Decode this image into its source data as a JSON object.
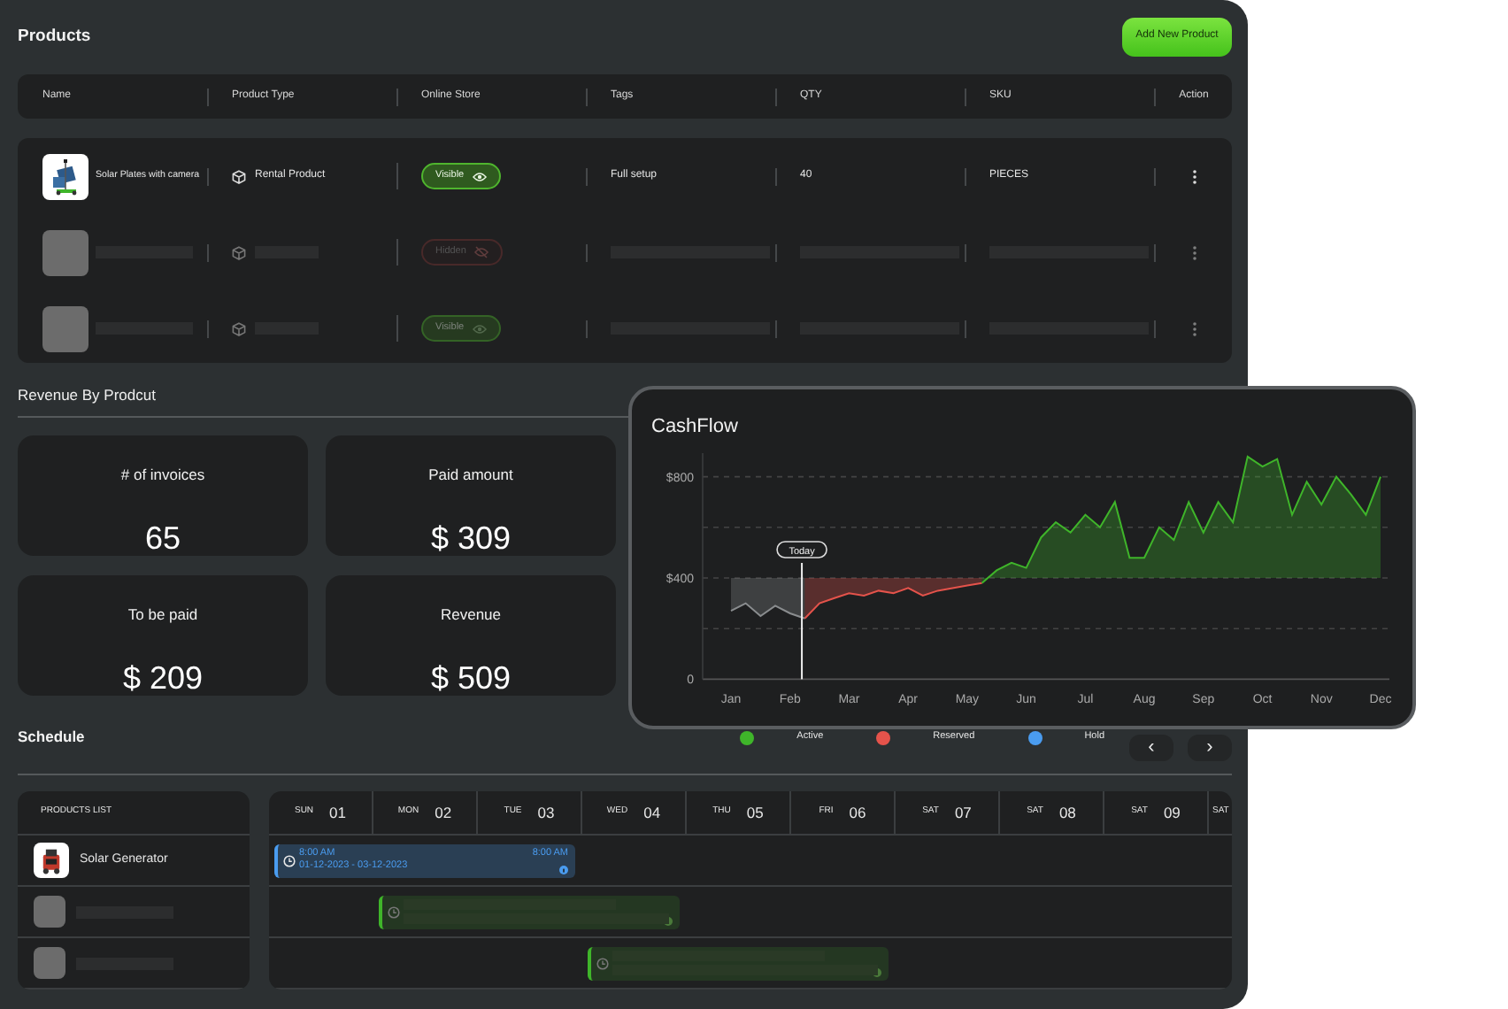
{
  "products": {
    "title": "Products",
    "add_button": "Add New Product",
    "columns": [
      "Name",
      "Product Type",
      "Online Store",
      "Tags",
      "QTY",
      "SKU",
      "Action"
    ],
    "rows": [
      {
        "kind": "item",
        "name": "Solar Plates with camera",
        "type": "Rental Product",
        "store": {
          "label": "Visible",
          "visible": true
        },
        "tags": "Full setup",
        "qty": "40",
        "sku": "PIECES"
      },
      {
        "kind": "placeholder",
        "store": {
          "label": "Hidden",
          "visible": false
        }
      },
      {
        "kind": "placeholder",
        "store": {
          "label": "Visible",
          "visible": true
        }
      }
    ]
  },
  "revenue": {
    "title": "Revenue By Prodcut",
    "cards": [
      {
        "label": "# of invoices",
        "value": "65"
      },
      {
        "label": "Paid amount",
        "value": "$ 309"
      },
      {
        "label": "To be paid",
        "value": "$ 209"
      },
      {
        "label": "Revenue",
        "value": "$ 509"
      }
    ]
  },
  "cashflow": {
    "title": "CashFlow",
    "chart_data": {
      "type": "line",
      "categories": [
        "Jan",
        null,
        null,
        null,
        "Feb",
        null,
        null,
        null,
        "Mar",
        null,
        null,
        null,
        "Apr",
        null,
        null,
        null,
        "May",
        null,
        null,
        null,
        "Jun",
        null,
        null,
        null,
        "Jul",
        null,
        null,
        null,
        "Aug",
        null,
        null,
        null,
        "Sep",
        null,
        null,
        null,
        "Oct",
        null,
        null,
        null,
        "Nov",
        null,
        null,
        null,
        "Dec"
      ],
      "series": [
        {
          "color": "#8a8d8f",
          "values": [
            270,
            300,
            250,
            290,
            260,
            240,
            null,
            null,
            null,
            null,
            null,
            null,
            null,
            null,
            null,
            null,
            null,
            null,
            null,
            null,
            null,
            null,
            null,
            null,
            null,
            null,
            null,
            null,
            null,
            null,
            null,
            null,
            null,
            null,
            null,
            null,
            null,
            null,
            null,
            null,
            null,
            null,
            null,
            null,
            null
          ]
        },
        {
          "color": "#e5534b",
          "values": [
            null,
            null,
            null,
            null,
            null,
            240,
            300,
            320,
            340,
            330,
            350,
            340,
            360,
            330,
            350,
            360,
            370,
            380,
            null,
            null,
            null,
            null,
            null,
            null,
            null,
            null,
            null,
            null,
            null,
            null,
            null,
            null,
            null,
            null,
            null,
            null,
            null,
            null,
            null,
            null,
            null,
            null,
            null,
            null,
            null
          ]
        },
        {
          "color": "#3fb52a",
          "values": [
            null,
            null,
            null,
            null,
            null,
            null,
            null,
            null,
            null,
            null,
            null,
            null,
            null,
            null,
            null,
            null,
            null,
            380,
            430,
            460,
            440,
            560,
            620,
            580,
            650,
            600,
            700,
            480,
            480,
            600,
            550,
            700,
            580,
            700,
            620,
            880,
            840,
            870,
            650,
            780,
            690,
            800,
            730,
            650,
            800
          ]
        }
      ],
      "yticks": [
        {
          "value": 0,
          "label": "0"
        },
        {
          "value": 400,
          "label": "$400"
        },
        {
          "value": 800,
          "label": "$800"
        }
      ],
      "ylim": [
        0,
        900
      ],
      "annotations": [
        "Today"
      ]
    }
  },
  "schedule": {
    "title": "Schedule",
    "legend": [
      {
        "label": "Active",
        "color": "#3fb52a"
      },
      {
        "label": "Reserved",
        "color": "#e5534b"
      },
      {
        "label": "Hold",
        "color": "#4a9cf0"
      }
    ],
    "nav": [
      "‹",
      "›"
    ],
    "list_header": "PRODUCTS LIST",
    "days": [
      {
        "day": "SUN",
        "date": "01"
      },
      {
        "day": "MON",
        "date": "02"
      },
      {
        "day": "TUE",
        "date": "03"
      },
      {
        "day": "WED",
        "date": "04"
      },
      {
        "day": "THU",
        "date": "05"
      },
      {
        "day": "FRI",
        "date": "06"
      },
      {
        "day": "SAT",
        "date": "07"
      },
      {
        "day": "SAT",
        "date": "08"
      },
      {
        "day": "SAT",
        "date": "09"
      },
      {
        "day": "SAT"
      }
    ],
    "rows": [
      {
        "kind": "item",
        "name": "Solar Generator",
        "booking": {
          "kind": "booking",
          "color": "#4a9cf0",
          "start_time": "8:00 AM",
          "end_time": "8:00 AM",
          "dates": "01-12-2023 - 03-12-2023"
        }
      },
      {
        "kind": "placeholder",
        "booking": {
          "kind": "placeholder",
          "color": "#3fb52a"
        }
      },
      {
        "kind": "placeholder",
        "booking": {
          "kind": "placeholder",
          "color": "#3fb52a"
        }
      }
    ]
  }
}
